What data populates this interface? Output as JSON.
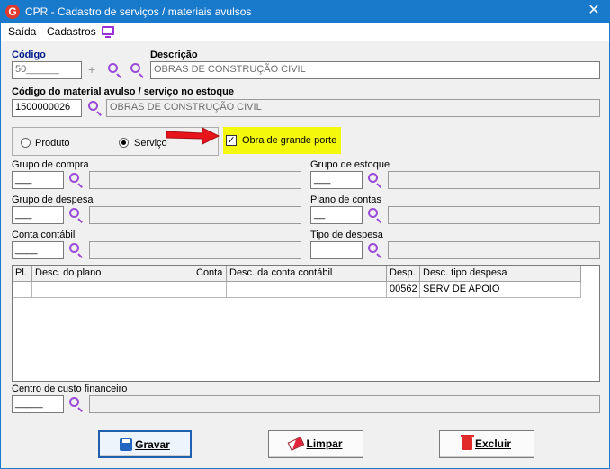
{
  "window": {
    "title": "CPR - Cadastro de serviços / materiais avulsos",
    "icon_letter": "G"
  },
  "menu": {
    "items": [
      "Saída",
      "Cadastros"
    ]
  },
  "codigo": {
    "label": "Código",
    "value": "50______"
  },
  "descricao": {
    "label": "Descrição",
    "value": "OBRAS DE CONSTRUÇÃO CIVIL"
  },
  "material": {
    "label": "Código do material avulso / serviço no estoque",
    "code": "1500000026",
    "desc": "OBRAS DE CONSTRUÇÃO CIVIL"
  },
  "tipo": {
    "options": [
      "Produto",
      "Serviço"
    ],
    "selected": "Serviço"
  },
  "obra": {
    "label": "Obra de grande porte",
    "checked": true,
    "check_mark": "✓"
  },
  "fields": {
    "grupo_compra": {
      "label": "Grupo de compra",
      "value": "___"
    },
    "grupo_estoque": {
      "label": "Grupo de estoque",
      "value": "___"
    },
    "grupo_despesa": {
      "label": "Grupo de despesa",
      "value": "___"
    },
    "plano_contas": {
      "label": "Plano de contas",
      "value": "__"
    },
    "conta_contabil": {
      "label": "Conta contábil",
      "value": "____"
    },
    "tipo_despesa": {
      "label": "Tipo de despesa",
      "value": ""
    },
    "centro_custo": {
      "label": "Centro de custo financeiro",
      "value": "_____"
    }
  },
  "grid": {
    "headers": [
      "Pl.",
      "Desc. do plano",
      "Conta",
      "Desc. da conta contábil",
      "Desp.",
      "Desc. tipo despesa"
    ],
    "rows": [
      [
        "",
        "",
        "",
        "",
        "00562",
        "SERV DE APOIO"
      ]
    ]
  },
  "buttons": {
    "gravar": "Gravar",
    "limpar": "Limpar",
    "excluir": "Excluir"
  },
  "colors": {
    "titlebar": "#1979ca",
    "accent_icon": "#9b4bd8",
    "highlight": "#f4f80b",
    "arrow": "#e8141c"
  }
}
